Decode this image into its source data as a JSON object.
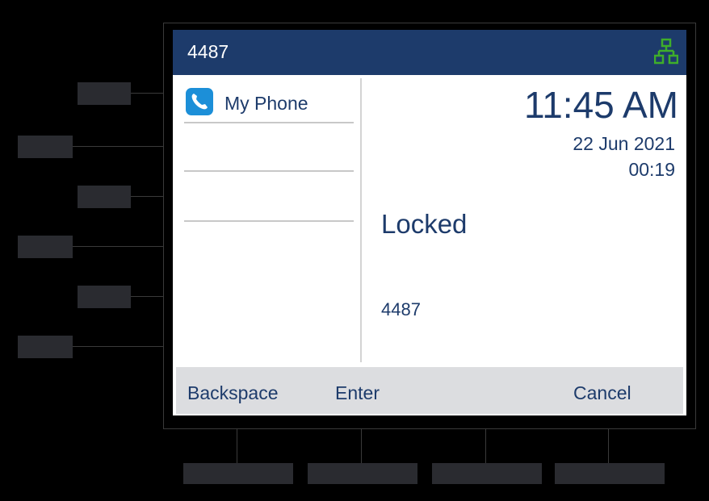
{
  "header": {
    "extension": "4487",
    "network_icon": "network-icon",
    "network_color": "#3fae2a"
  },
  "line_keys": [
    {
      "label": "My Phone",
      "icon": "phone-icon"
    },
    {
      "label": ""
    },
    {
      "label": ""
    }
  ],
  "clock": {
    "time": "11:45 AM",
    "date": "22 Jun 2021",
    "duration": "00:19"
  },
  "status": {
    "text": "Locked",
    "entry": "4487"
  },
  "softkeys": [
    {
      "label": "Backspace"
    },
    {
      "label": "Enter"
    },
    {
      "label": ""
    },
    {
      "label": "Cancel"
    }
  ],
  "colors": {
    "title_bar": "#1d3b6b",
    "text": "#1d3b6b",
    "softkey_bar": "#dcdde0",
    "phone_icon": "#1c8fd8"
  }
}
